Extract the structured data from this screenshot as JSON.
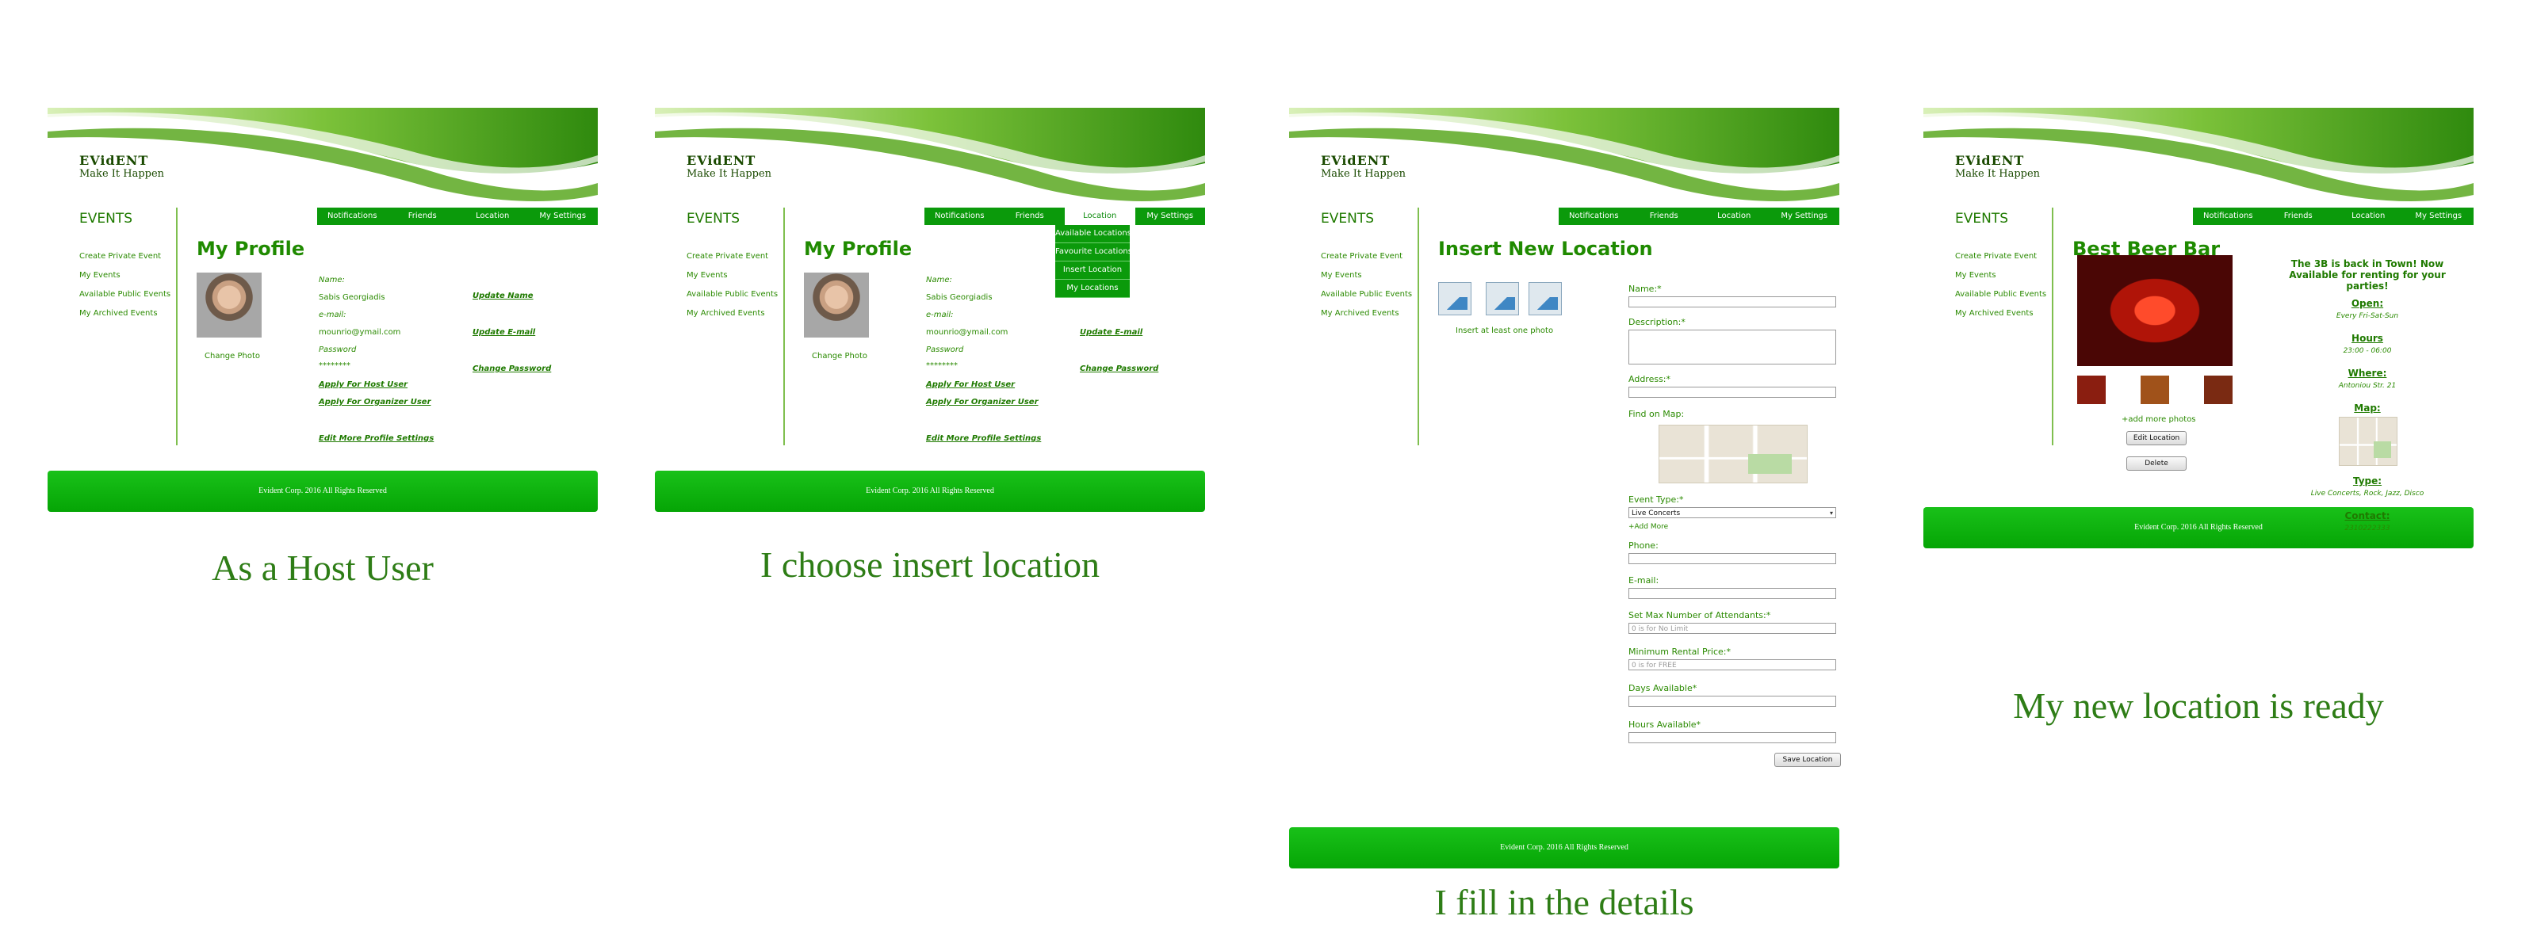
{
  "common": {
    "brand_title": "EVidENT",
    "brand_subtitle": "Make It Happen",
    "events_heading": "EVENTS",
    "sidebar": [
      "Create Private Event",
      "My Events",
      "Available Public Events",
      "My Archived Events"
    ],
    "nav": [
      "Notifications",
      "Friends",
      "Location",
      "My Settings"
    ],
    "footer": "Evident Corp. 2016 All Rights Reserved"
  },
  "captions": {
    "host": "As a Host User",
    "insert": "I choose insert location",
    "fill": "I fill in the details",
    "ready": "My new location is ready"
  },
  "profile": {
    "title": "My Profile",
    "change_photo": "Change Photo",
    "name_label": "Name:",
    "name_value": "Sabis Georgiadis",
    "email_label": "e-mail:",
    "email_value": "mounrio@ymail.com",
    "password_label": "Password",
    "password_value": "********",
    "apply_host": "Apply For Host User",
    "apply_organizer": "Apply For Organizer User",
    "edit_more": "Edit More Profile Settings",
    "update_name": "Update Name",
    "update_email": "Update E-mail",
    "change_password": "Change Password"
  },
  "location_menu": [
    "Available Locations",
    "Favourite Locations",
    "Insert Location",
    "My Locations"
  ],
  "insert_form": {
    "title": "Insert New Location",
    "photo_hint": "Insert at least one photo",
    "name_label": "Name:*",
    "description_label": "Description:*",
    "address_label": "Address:*",
    "map_label": "Find on Map:",
    "event_type_label": "Event Type:*",
    "event_type_value": "Live Concerts",
    "add_more": "+Add More",
    "phone_label": "Phone:",
    "email_label": "E-mail:",
    "max_label": "Set Max Number of Attendants:*",
    "max_placeholder": "0 is for No Limit",
    "min_price_label": "Minimum Rental Price:*",
    "min_price_placeholder": "0 is for FREE",
    "days_label": "Days Available*",
    "hours_label": "Hours Available*",
    "save_button": "Save Location"
  },
  "location_page": {
    "title": "Best Beer Bar",
    "add_photos": "+add more photos",
    "edit_button": "Edit Location",
    "delete_button": "Delete",
    "promo": "The 3B is back in Town! Now Available for renting for your parties!",
    "open_label": "Open:",
    "open_value": "Every Fri-Sat-Sun",
    "hours_label": "Hours",
    "hours_value": "23:00 - 06:00",
    "where_label": "Where:",
    "where_value": "Antoniou Str. 21",
    "map_label": "Map:",
    "type_label": "Type:",
    "type_value": "Live Concerts, Rock, Jazz, Disco",
    "contact_label": "Contact:",
    "contact_value": "2310222333"
  },
  "colors": {
    "brand_green": "#0b9a0b",
    "text_green": "#2a8a00",
    "caption_green": "#2e7d16"
  }
}
